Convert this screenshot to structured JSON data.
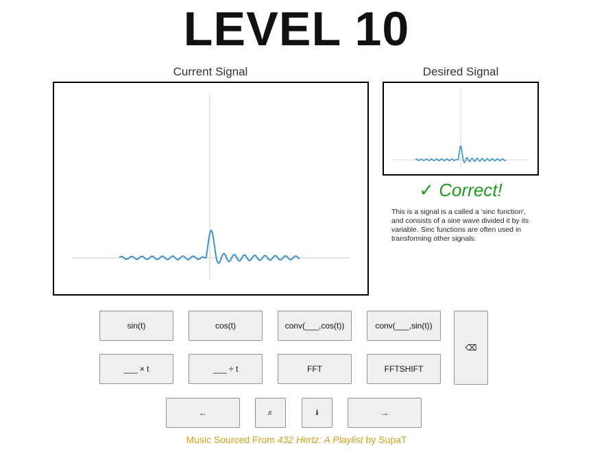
{
  "title": "LEVEL 10",
  "current_panel": {
    "label": "Current Signal"
  },
  "desired_panel": {
    "label": "Desired Signal"
  },
  "feedback": {
    "status": "✓ Correct!",
    "description": "This is a signal is a called a 'sinc function', and consists of a sine wave divided it by its variable. Sinc functions are often used in transforming other signals."
  },
  "buttons": {
    "sin": "sin(t)",
    "cos": "cos(t)",
    "conv_cos": "conv(___,cos(t))",
    "conv_sin": "conv(___,sin(t))",
    "times_t": "___ × t",
    "div_t": "___ ÷ t",
    "fft": "FFT",
    "fftshift": "FFTSHIFT",
    "backspace": "⌫",
    "left": "←",
    "music": "♬",
    "info": "ℹ",
    "right": "→"
  },
  "footer": {
    "prefix": "Music Sourced From ",
    "playlist": "432 Hertz: A Playlist",
    "by": " by ",
    "artist": "SupaT"
  },
  "colors": {
    "signal": "#3a93d0",
    "axis": "#d3d3d3",
    "correct": "#1e9a1e",
    "footer": "#d4a017"
  }
}
